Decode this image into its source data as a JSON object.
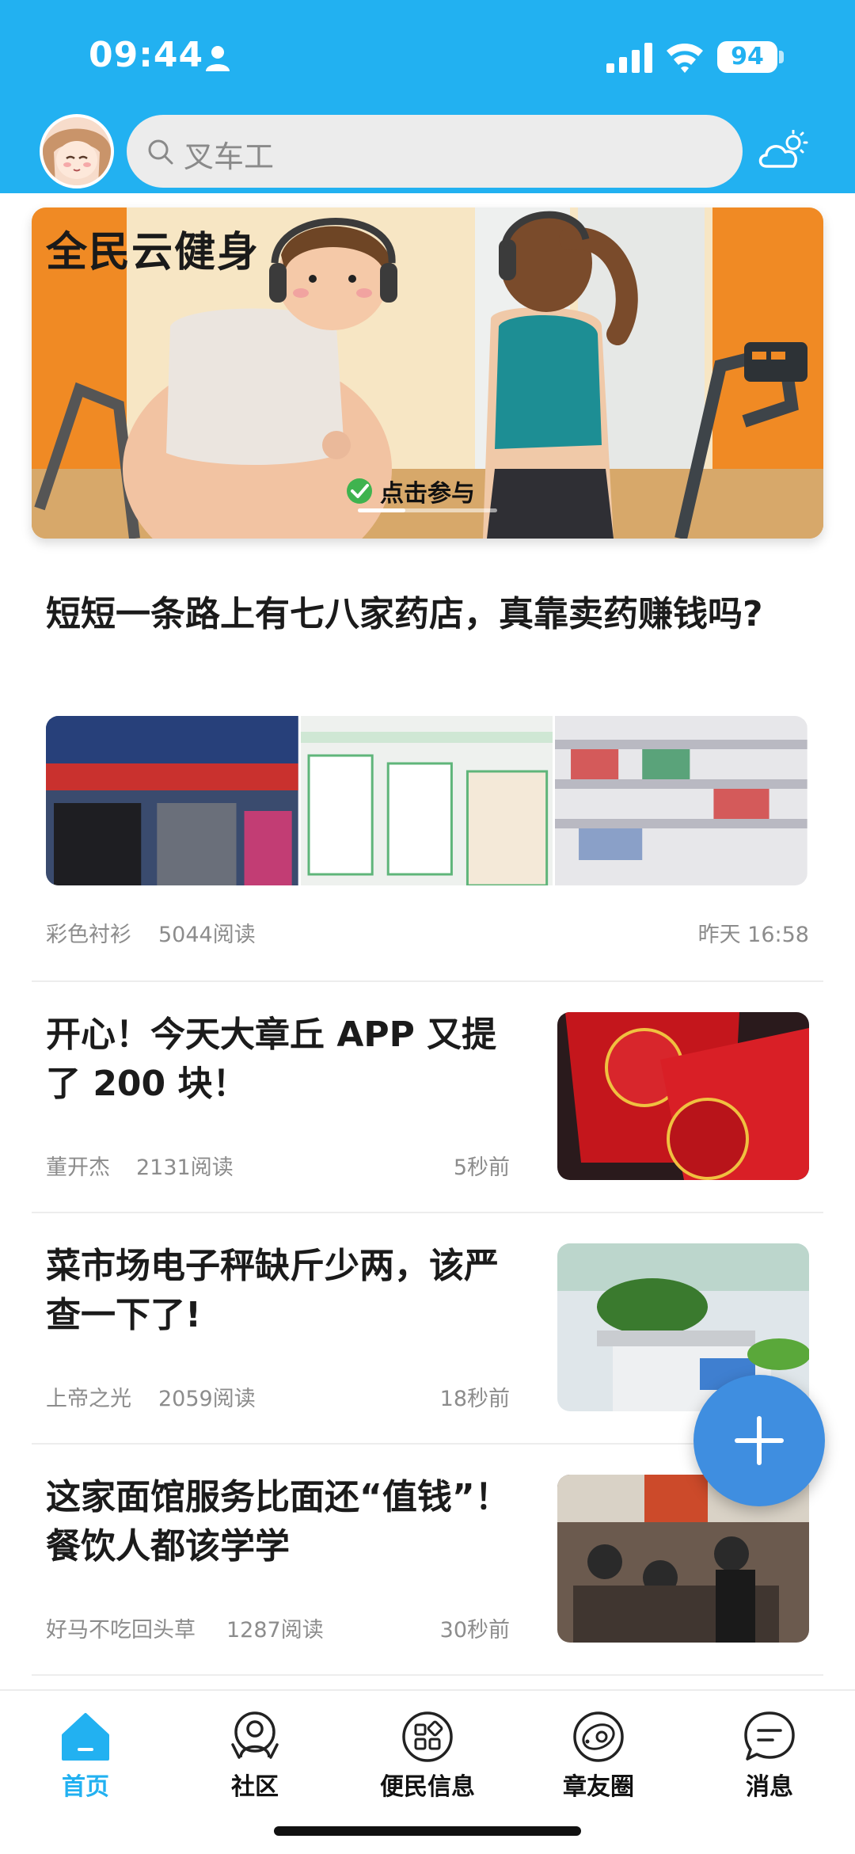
{
  "status_bar": {
    "time": "09:44",
    "battery": "94"
  },
  "search": {
    "placeholder": "叉车工"
  },
  "banner": {
    "title": "全民云健身",
    "cta": "点击参与"
  },
  "articles": [
    {
      "title": "短短一条路上有七八家药店，真靠卖药赚钱吗?",
      "author": "彩色衬衫",
      "reads": "5044阅读",
      "time": "昨天 16:58"
    },
    {
      "title": "开心！今天大章丘 APP 又提了 200 块！",
      "author": "董开杰",
      "reads": "2131阅读",
      "time": "5秒前"
    },
    {
      "title": "菜市场电子秤缺斤少两，该严查一下了!",
      "author": "上帝之光",
      "reads": "2059阅读",
      "time": "18秒前"
    },
    {
      "title": "这家面馆服务比面还“值钱”！餐饮人都该学学",
      "author": "好马不吃回头草",
      "reads": "1287阅读",
      "time": "30秒前"
    }
  ],
  "nav": [
    {
      "label": "首页",
      "icon": "home-icon",
      "active": true
    },
    {
      "label": "社区",
      "icon": "community-icon",
      "active": false
    },
    {
      "label": "便民信息",
      "icon": "apps-icon",
      "active": false
    },
    {
      "label": "章友圈",
      "icon": "planet-icon",
      "active": false
    },
    {
      "label": "消息",
      "icon": "message-icon",
      "active": false
    }
  ],
  "colors": {
    "brand": "#22b1f1",
    "fab": "#3f8ee0"
  }
}
